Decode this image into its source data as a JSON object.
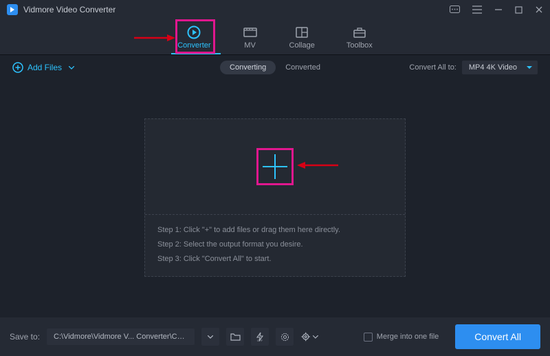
{
  "app": {
    "title": "Vidmore Video Converter"
  },
  "tabs": {
    "converter": "Converter",
    "mv": "MV",
    "collage": "Collage",
    "toolbox": "Toolbox"
  },
  "toolbar": {
    "add_files": "Add Files",
    "seg_converting": "Converting",
    "seg_converted": "Converted",
    "convert_all_to_label": "Convert All to:",
    "convert_all_to_value": "MP4 4K Video"
  },
  "dropzone": {
    "step1": "Step 1: Click \"+\" to add files or drag them here directly.",
    "step2": "Step 2: Select the output format you desire.",
    "step3": "Step 3: Click \"Convert All\" to start."
  },
  "bottombar": {
    "saveto_label": "Save to:",
    "path": "C:\\Vidmore\\Vidmore V... Converter\\Converted",
    "merge_label": "Merge into one file",
    "convert_all": "Convert All"
  }
}
